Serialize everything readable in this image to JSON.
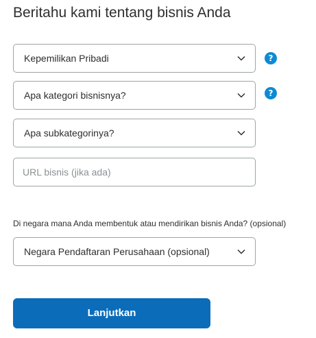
{
  "page": {
    "title": "Beritahu kami tentang bisnis Anda"
  },
  "form": {
    "ownership": {
      "value": "Kepemilikan Pribadi",
      "help_icon": "help-question-icon"
    },
    "category": {
      "value": "Apa kategori bisnisnya?",
      "help_icon": "help-question-icon"
    },
    "subcategory": {
      "value": "Apa subkategorinya?"
    },
    "business_url": {
      "placeholder": "URL bisnis (jika ada)",
      "value": ""
    },
    "country_question": "Di negara mana Anda membentuk atau mendirikan bisnis Anda? (opsional)",
    "country": {
      "value": "Negara Pendaftaran Perusahaan (opsional)"
    },
    "help_glyph": "?",
    "submit_label": "Lanjutkan"
  },
  "colors": {
    "primary_button": "#0b6cba",
    "help_icon": "#0d8ad4",
    "field_border": "#9da3a6",
    "text": "#2c2e2f",
    "placeholder": "#8a9093"
  }
}
